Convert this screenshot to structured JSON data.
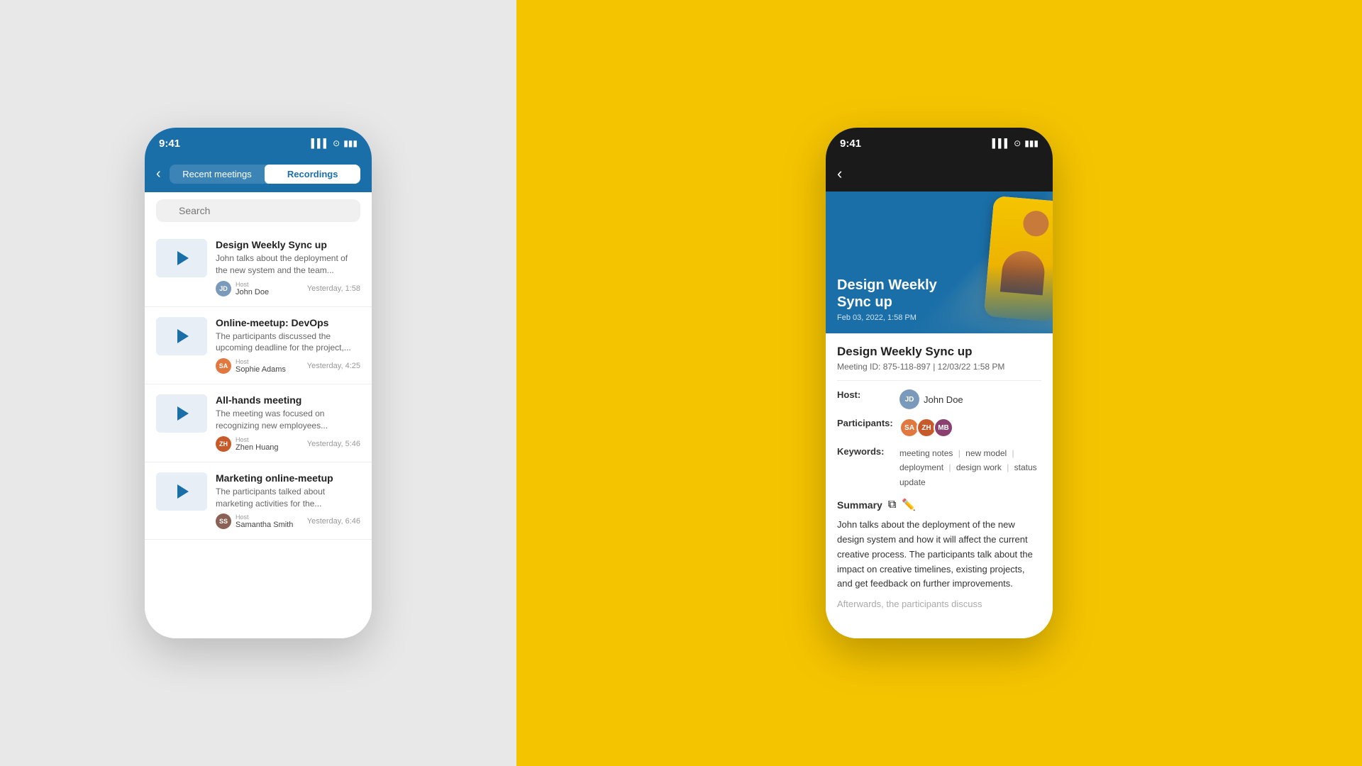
{
  "left": {
    "background": "#e8e8e8",
    "phone": {
      "statusBar": {
        "time": "9:41",
        "icons": [
          "▌▌▌",
          "⊙",
          "▮▮▮"
        ]
      },
      "nav": {
        "backLabel": "‹",
        "tabs": [
          {
            "label": "Recent meetings",
            "active": false
          },
          {
            "label": "Recordings",
            "active": true
          }
        ]
      },
      "search": {
        "placeholder": "Search"
      },
      "recordings": [
        {
          "title": "Design Weekly Sync up",
          "description": "John talks about the deployment of the new system and the team...",
          "hostLabel": "Host",
          "hostName": "John Doe",
          "time": "Yesterday, 1:58",
          "avatarColor": "#7a9abc",
          "avatarInitials": "JD"
        },
        {
          "title": "Online-meetup: DevOps",
          "description": "The participants discussed the upcoming deadline for the project,...",
          "hostLabel": "Host",
          "hostName": "Sophie Adams",
          "time": "Yesterday, 4:25",
          "avatarColor": "#e07840",
          "avatarInitials": "SA"
        },
        {
          "title": "All-hands meeting",
          "description": "The meeting was focused on recognizing new employees...",
          "hostLabel": "Host",
          "hostName": "Zhen Huang",
          "time": "Yesterday, 5:46",
          "avatarColor": "#c85a2a",
          "avatarInitials": "ZH"
        },
        {
          "title": "Marketing online-meetup",
          "description": "The participants talked about marketing activities for the...",
          "hostLabel": "Host",
          "hostName": "Samantha Smith",
          "time": "Yesterday, 6:46",
          "avatarColor": "#8b6055",
          "avatarInitials": "SS"
        }
      ]
    }
  },
  "right": {
    "background": "#F5C400",
    "phone": {
      "statusBar": {
        "time": "9:41",
        "icons": [
          "▌▌▌",
          "⊙",
          "▮▮▮"
        ]
      },
      "backLabel": "‹",
      "headerTitle": "Design Weekly\nSync up",
      "headerDate": "Feb 03, 2022, 1:58 PM",
      "detail": {
        "title": "Design Weekly Sync up",
        "meetingId": "Meeting ID: 875-118-897 | 12/03/22 1:58 PM",
        "hostLabel": "Host:",
        "hostName": "John Doe",
        "hostAvatarColor": "#7a9abc",
        "hostAvatarInitials": "JD",
        "participantsLabel": "Participants:",
        "participants": [
          {
            "color": "#e07840",
            "initials": "SA"
          },
          {
            "color": "#c85a2a",
            "initials": "ZH"
          },
          {
            "color": "#8b4070",
            "initials": "MB"
          }
        ],
        "keywordsLabel": "Keywords:",
        "keywords": [
          "meeting notes",
          "new model",
          "deployment",
          "design work",
          "status update"
        ],
        "summaryLabel": "Summary",
        "summaryText": "John talks about the deployment of the new design system and how it will affect the current creative process. The participants talk about the impact on creative timelines, existing projects, and get feedback on further improvements.",
        "summaryFade": "Afterwards, the participants discuss"
      }
    }
  }
}
